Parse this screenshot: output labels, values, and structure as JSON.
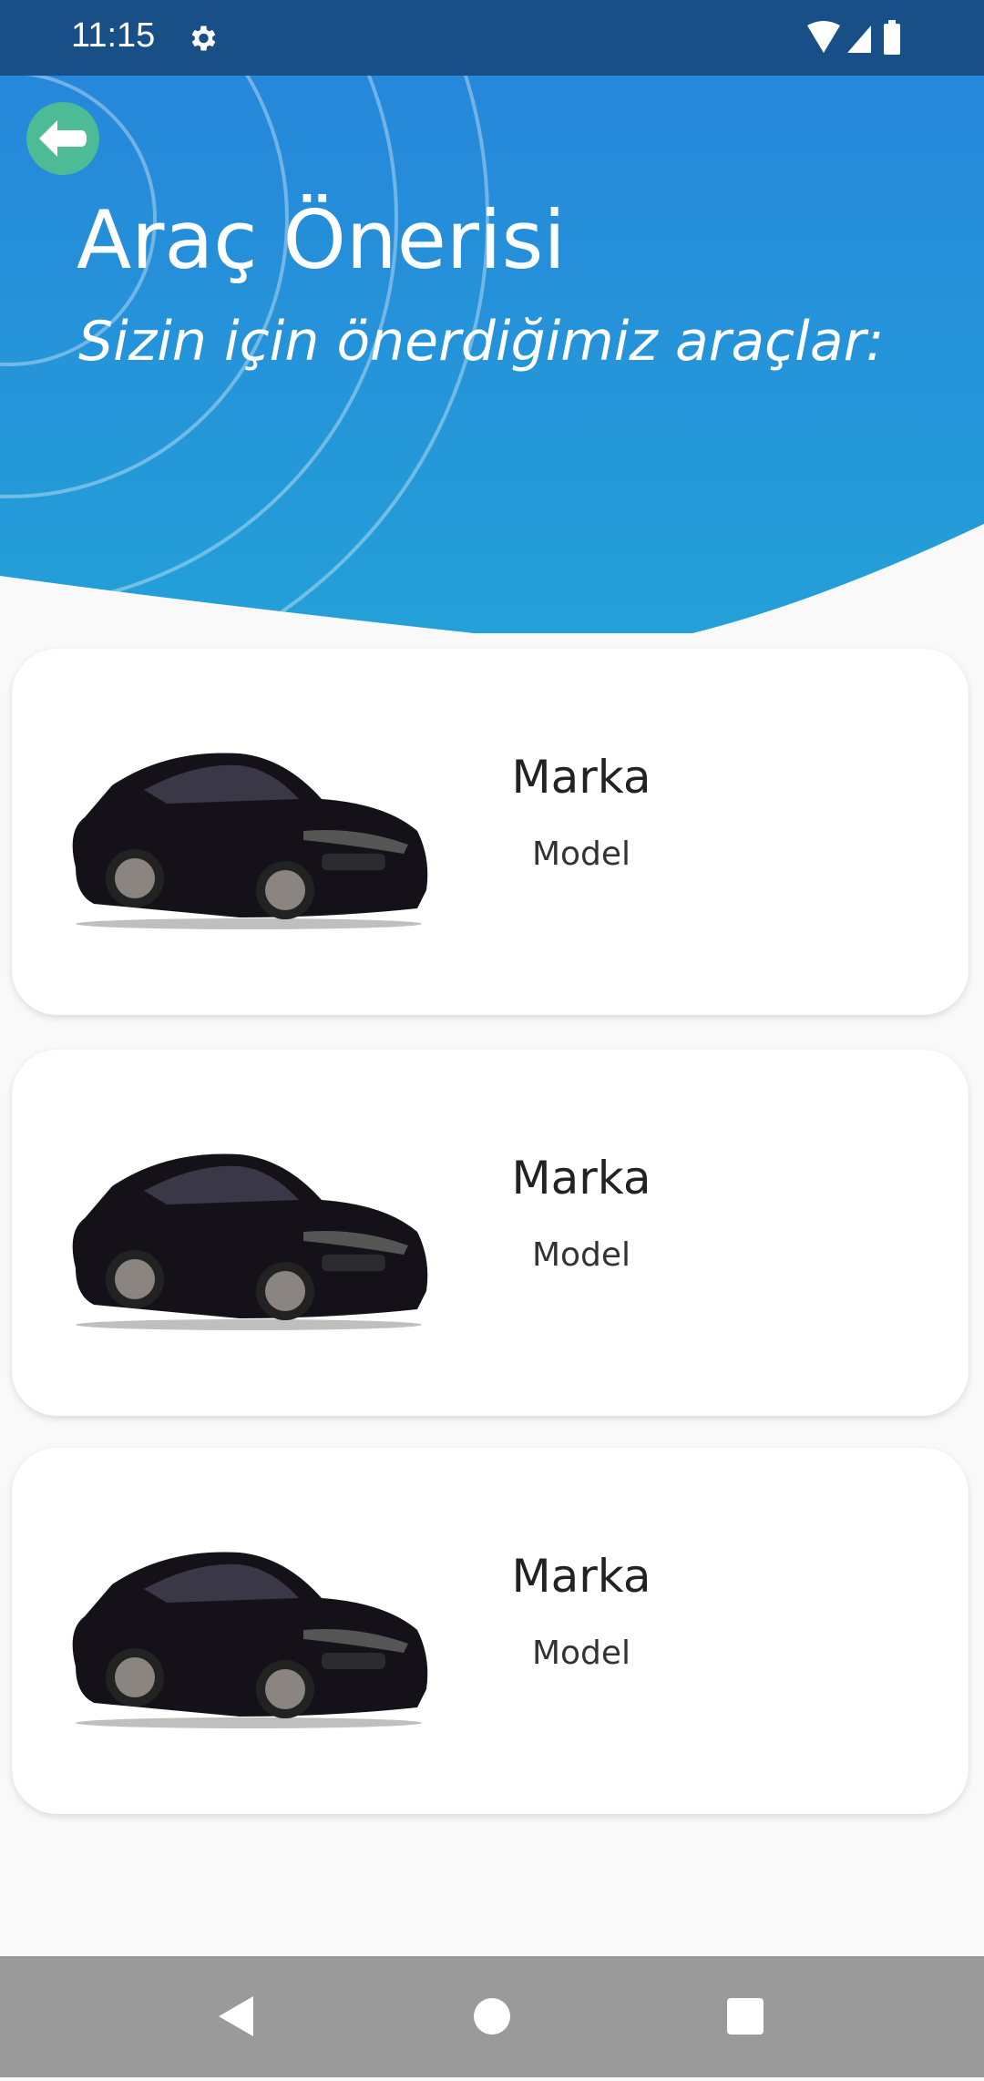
{
  "status_bar": {
    "time": "11:15",
    "icons": [
      "gear-icon",
      "wifi-icon",
      "signal-icon",
      "battery-icon"
    ]
  },
  "header": {
    "title": "Araç Önerisi",
    "subtitle": "Sizin için önerdiğimiz araçlar:",
    "back_icon": "arrow-left-icon"
  },
  "colors": {
    "status_bar": "#174f86",
    "header_top": "#2684da",
    "header_bottom": "#24a0d8",
    "back_button": "#4cbb96",
    "nav_bar": "#9a9a9a"
  },
  "cards": [
    {
      "brand": "Marka",
      "model": "Model"
    },
    {
      "brand": "Marka",
      "model": "Model"
    },
    {
      "brand": "Marka",
      "model": "Model"
    }
  ],
  "nav_bar": {
    "icons": [
      "back-triangle-icon",
      "home-circle-icon",
      "recents-square-icon"
    ]
  }
}
